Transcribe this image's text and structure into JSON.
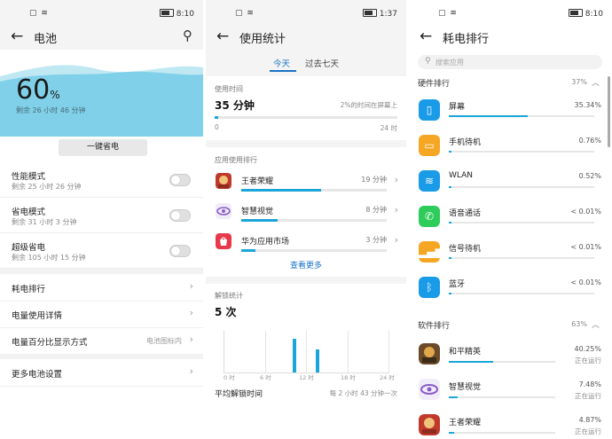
{
  "status": {
    "p1_time": "8:10",
    "p2_time": "1:37",
    "p3_time": "8:10"
  },
  "battery": {
    "title": "电池",
    "percent": "60",
    "percent_sign": "%",
    "remaining": "剩余 26 小时 46 分钟",
    "one_key_save": "一键省电",
    "modes": [
      {
        "title": "性能模式",
        "sub": "剩余 25 小时 26 分钟",
        "on": false
      },
      {
        "title": "省电模式",
        "sub": "剩余 31 小时 3 分钟",
        "on": false
      },
      {
        "title": "超级省电",
        "sub": "剩余 105 小时 15 分钟",
        "on": false
      }
    ],
    "rows": [
      {
        "title": "耗电排行",
        "value": ""
      },
      {
        "title": "电量使用详情",
        "value": ""
      },
      {
        "title": "电量百分比显示方式",
        "value": "电池图标内"
      },
      {
        "title": "更多电池设置",
        "value": ""
      }
    ]
  },
  "usage": {
    "title": "使用统计",
    "tab_today": "今天",
    "tab_week": "过去七天",
    "time_label": "使用时间",
    "time_value": "35 分钟",
    "time_note": "2%的时间在屏幕上",
    "axis_start": "0",
    "axis_end": "24 时",
    "time_fraction": 0.02,
    "app_rank_label": "应用使用排行",
    "apps": [
      {
        "name": "王者荣耀",
        "value": "19 分钟",
        "fraction": 0.55
      },
      {
        "name": "智慧视觉",
        "value": "8 分钟",
        "fraction": 0.25
      },
      {
        "name": "华为应用市场",
        "value": "3 分钟",
        "fraction": 0.1
      }
    ],
    "see_more": "查看更多",
    "unlock_label": "解锁统计",
    "unlock_value": "5 次",
    "ticks": [
      "0 时",
      "6 时",
      "12 时",
      "18 时",
      "24 时"
    ],
    "avg_label": "平均解锁时间",
    "avg_value": "每 2 小时 43 分钟一次"
  },
  "ranking": {
    "title": "耗电排行",
    "search_placeholder": "搜索应用",
    "hw_label": "硬件排行",
    "hw_value": "37%",
    "hardware": [
      {
        "name": "屏幕",
        "value": "35.34%",
        "color": "#1a9be8",
        "fraction": 0.54
      },
      {
        "name": "手机待机",
        "value": "0.76%",
        "color": "#f5a623",
        "fraction": 0.02
      },
      {
        "name": "WLAN",
        "value": "0.52%",
        "color": "#1a9be8",
        "fraction": 0.015
      },
      {
        "name": "语音通话",
        "value": "< 0.01%",
        "color": "#2ecc5a",
        "fraction": 0.005
      },
      {
        "name": "信号待机",
        "value": "< 0.01%",
        "color": "#f5a623",
        "fraction": 0.005
      },
      {
        "name": "蓝牙",
        "value": "< 0.01%",
        "color": "#1a9be8",
        "fraction": 0.005
      }
    ],
    "sw_label": "软件排行",
    "sw_value": "63%",
    "software": [
      {
        "name": "和平精英",
        "value": "40.25%",
        "status": "正在运行",
        "fraction": 0.42
      },
      {
        "name": "智慧视觉",
        "value": "7.48%",
        "status": "正在运行",
        "fraction": 0.08
      },
      {
        "name": "王者荣耀",
        "value": "4.87%",
        "status": "正在运行",
        "fraction": 0.05
      }
    ]
  }
}
